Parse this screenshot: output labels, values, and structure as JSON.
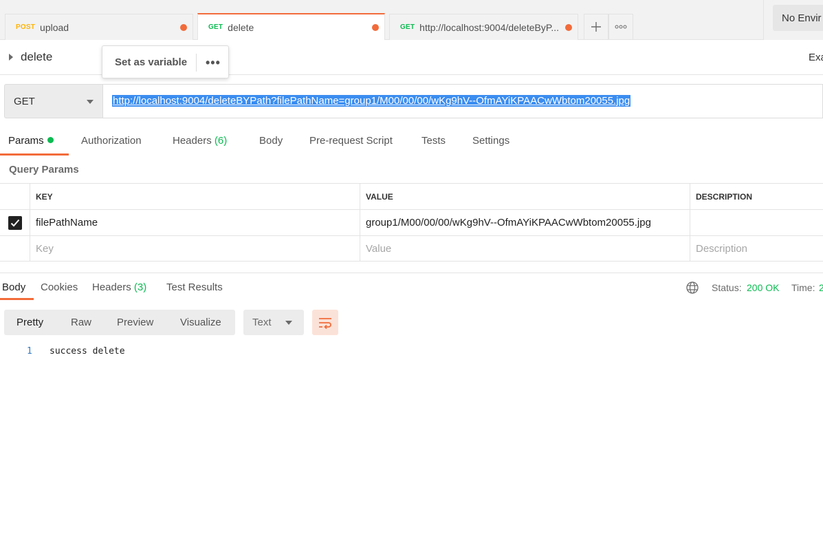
{
  "tabs": [
    {
      "method": "POST",
      "name": "upload"
    },
    {
      "method": "GET",
      "name": "delete"
    },
    {
      "method": "GET",
      "name": "http://localhost:9004/deleteByP..."
    }
  ],
  "tab_actions": {
    "add_icon": "plus-icon",
    "more_icon": "more-horizontal-icon"
  },
  "environment": {
    "label": "No Envir"
  },
  "request": {
    "name": "delete",
    "examples_label": "Exa",
    "method": "GET",
    "url": "http://localhost:9004/deleteBYPath?filePathName=group1/M00/00/00/wKg9hV--OfmAYiKPAACwWbtom20055.jpg"
  },
  "popover": {
    "set_variable": "Set as variable",
    "more": "•••"
  },
  "request_tabs": [
    {
      "label": "Params",
      "count": ""
    },
    {
      "label": "Authorization",
      "count": ""
    },
    {
      "label": "Headers",
      "count": "(6)"
    },
    {
      "label": "Body",
      "count": ""
    },
    {
      "label": "Pre-request Script",
      "count": ""
    },
    {
      "label": "Tests",
      "count": ""
    },
    {
      "label": "Settings",
      "count": ""
    }
  ],
  "query_params": {
    "title": "Query Params",
    "headers": [
      "KEY",
      "VALUE",
      "DESCRIPTION"
    ],
    "rows": [
      {
        "checked": true,
        "key": "filePathName",
        "value": "group1/M00/00/00/wKg9hV--OfmAYiKPAACwWbtom20055.jpg",
        "description": ""
      }
    ],
    "placeholders": {
      "key": "Key",
      "value": "Value",
      "description": "Description"
    }
  },
  "response": {
    "tabs": [
      {
        "label": "Body",
        "count": ""
      },
      {
        "label": "Cookies",
        "count": ""
      },
      {
        "label": "Headers",
        "count": "(3)"
      },
      {
        "label": "Test Results",
        "count": ""
      }
    ],
    "status_label": "Status:",
    "status_value": "200 OK",
    "time_label": "Time:",
    "time_value": "2",
    "view_modes": [
      "Pretty",
      "Raw",
      "Preview",
      "Visualize"
    ],
    "format": "Text",
    "lines": [
      {
        "number": "1",
        "text": "success delete"
      }
    ]
  },
  "colors": {
    "accent": "#f26b3a",
    "success": "#0cbb52",
    "post": "#ffb400",
    "selection": "#3b8df0"
  }
}
